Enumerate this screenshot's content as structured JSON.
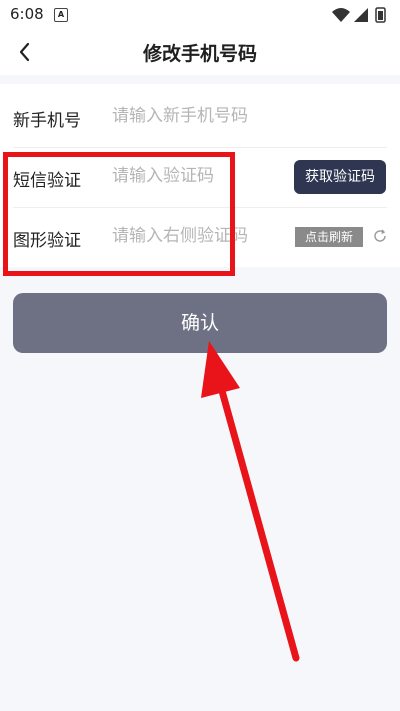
{
  "status_bar": {
    "time": "6:08",
    "notification_icon": "A"
  },
  "header": {
    "title": "修改手机号码",
    "back_icon": "chevron-left"
  },
  "form": {
    "new_phone": {
      "label": "新手机号",
      "placeholder": "请输入新手机号码"
    },
    "sms_code": {
      "label": "短信验证",
      "placeholder": "请输入验证码",
      "button_label": "获取验证码"
    },
    "image_code": {
      "label": "图形验证",
      "placeholder": "请输入右侧验证码",
      "captcha_text": "点击刷新"
    }
  },
  "confirm_button": {
    "label": "确认"
  },
  "colors": {
    "primary_dark": "#2e3651",
    "confirm_bg": "#6d7183",
    "annotation_red": "#e8141a"
  }
}
